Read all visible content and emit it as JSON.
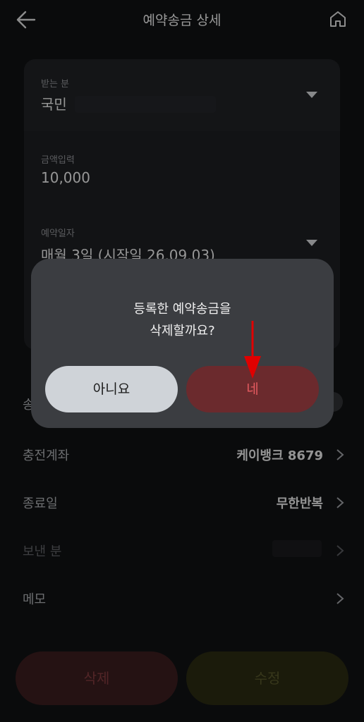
{
  "header": {
    "title": "예약송금 상세"
  },
  "form": {
    "recipient_label": "받는 분",
    "recipient_value": "국민",
    "amount_label": "금액입력",
    "amount_value": "10,000",
    "schedule_label": "예약일자",
    "schedule_value": "매월 3일 (시작일 26.09.03)"
  },
  "rows": {
    "partial_label": "송",
    "charge_account_label": "충전계좌",
    "charge_account_value": "케이뱅크 8679",
    "end_date_label": "종료일",
    "end_date_value": "무한반복",
    "sender_label": "보낸 분",
    "memo_label": "메모"
  },
  "bottom_buttons": {
    "delete_label": "삭제",
    "edit_label": "수정"
  },
  "dialog": {
    "line1": "등록한 예약송금을",
    "line2": "삭제할까요?",
    "no_label": "아니요",
    "yes_label": "네"
  },
  "colors": {
    "background": "#101113",
    "dialog_bg": "#3b3d41",
    "no_button": "#cfd3d8",
    "yes_button": "#6b2a2d",
    "yes_text": "#e45a5f",
    "annotation_arrow": "#e00000"
  }
}
